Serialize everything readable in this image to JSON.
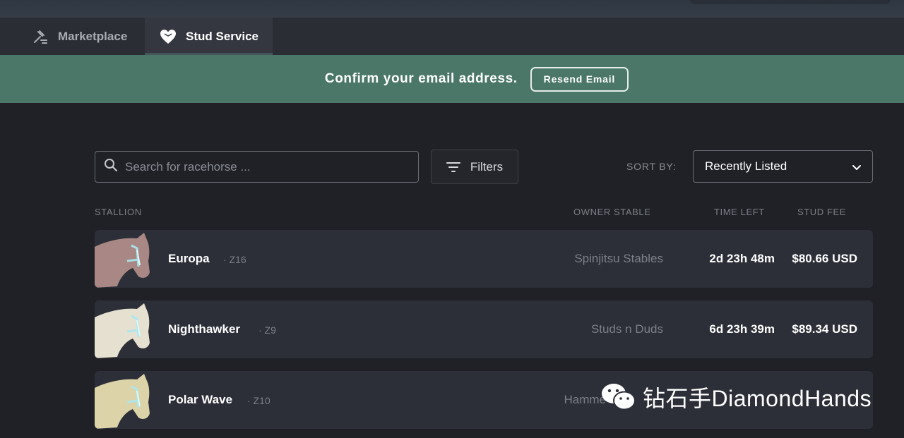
{
  "tabs": [
    {
      "label": "Marketplace",
      "icon": "gavel-icon",
      "active": false
    },
    {
      "label": "Stud Service",
      "icon": "heart-icon",
      "active": true
    }
  ],
  "banner": {
    "message": "Confirm your email address.",
    "button_label": "Resend Email",
    "bg_color": "#4a7767"
  },
  "search": {
    "placeholder": "Search for racehorse ...",
    "value": ""
  },
  "filters": {
    "label": "Filters"
  },
  "sort": {
    "label": "SORT BY:",
    "selected": "Recently Listed"
  },
  "columns": {
    "stallion": "STALLION",
    "owner": "OWNER STABLE",
    "time": "TIME LEFT",
    "fee": "STUD FEE"
  },
  "rows": [
    {
      "name": "Europa",
      "gen": "· Z16",
      "owner": "Spinjitsu Stables",
      "time": "2d 23h 48m",
      "fee": "$80.66 USD",
      "coat": "#a88784"
    },
    {
      "name": "Nighthawker",
      "gen": "· Z9",
      "owner": "Studs n Duds",
      "time": "6d 23h 39m",
      "fee": "$89.34 USD",
      "coat": "#e5e0cf"
    },
    {
      "name": "Polar Wave",
      "gen": "· Z10",
      "owner": "Hamme",
      "time": "",
      "fee": "",
      "coat": "#ddd3a8"
    }
  ],
  "watermark": {
    "text": "钻石手DiamondHands"
  }
}
